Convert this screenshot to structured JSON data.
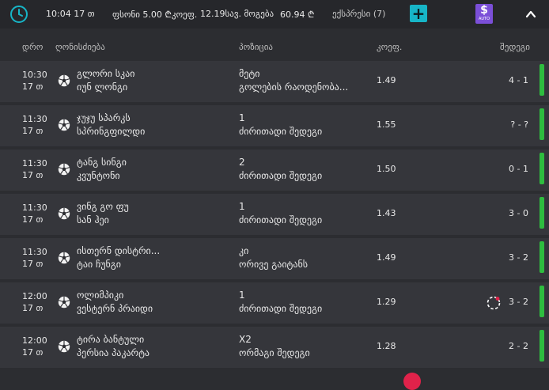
{
  "topbar": {
    "time": "10:04 17 თ",
    "odds": "ფსონი  5.00 ₾კოეფ.",
    "stake": "12.19სავ. მოგება",
    "win": "60.94 ₾",
    "express": "ექსპრესი (7)",
    "plus_label": "+",
    "auto_label": "AUTO",
    "auto_symbol": "$",
    "icons": [
      "clock-icon",
      "plus-icon",
      "auto-bet-icon",
      "chevron-up-icon"
    ],
    "colors": {
      "accent": "#17b5c7",
      "auto": "#7b4fd8",
      "status_green": "#2ebd3f"
    }
  },
  "table": {
    "headers": {
      "date": "დრო",
      "event": "ღონისძიება",
      "position": "პოზიცია",
      "odds": "კოეფ.",
      "result": "შედეგი"
    },
    "rows": [
      {
        "time": "10:30",
        "date": "17 თ",
        "team1": "გლორი სკაი",
        "team2": "იუნ ლონგი",
        "pick": "მეტი",
        "market": "გოლების რაოდენობა...",
        "odds": "1.49",
        "score": "4 - 1"
      },
      {
        "time": "11:30",
        "date": "17 თ",
        "team1": "ჯუჯუ სპარკს",
        "team2": "სპრინგფილდი",
        "pick": "1",
        "market": "ძირითადი შედეგი",
        "odds": "1.55",
        "score": "? - ?"
      },
      {
        "time": "11:30",
        "date": "17 თ",
        "team1": "ტანგ სინგი",
        "team2": "კვუნტონი",
        "pick": "2",
        "market": "ძირითადი შედეგი",
        "odds": "1.50",
        "score": "0 - 1"
      },
      {
        "time": "11:30",
        "date": "17 თ",
        "team1": "ვინგ გო ფუ",
        "team2": "სან ჰეი",
        "pick": "1",
        "market": "ძირითადი შედეგი",
        "odds": "1.43",
        "score": "3 - 0"
      },
      {
        "time": "11:30",
        "date": "17 თ",
        "team1": "ისთერნ დისტრი...",
        "team2": "ტაი ჩუნგი",
        "pick": "კი",
        "market": "ორივე გაიტანს",
        "odds": "1.49",
        "score": "3 - 2"
      },
      {
        "time": "12:00",
        "date": "17 თ",
        "team1": "ოლიმპიკი",
        "team2": "ვესტერნ პრაიდი",
        "pick": "1",
        "market": "ძირითადი შედეგი",
        "odds": "1.29",
        "score": "3 - 2"
      },
      {
        "time": "12:00",
        "date": "17 თ",
        "team1": "ტირა ბანტული",
        "team2": "პერსია პაკარტა",
        "pick": "X2",
        "market": "ორმაგი შედეგი",
        "odds": "1.28",
        "score": "2 - 2"
      }
    ]
  }
}
